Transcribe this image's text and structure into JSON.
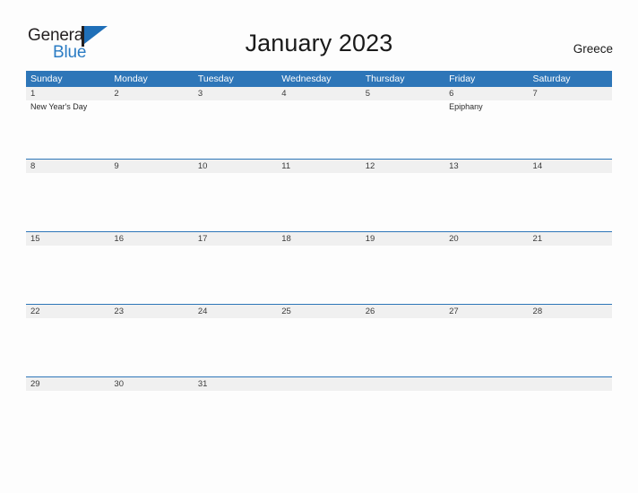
{
  "brand": {
    "name_part1": "General",
    "name_part2": "Blue",
    "flag_icon": "flag-icon",
    "accent_color": "#2b7cc4"
  },
  "header": {
    "title": "January 2023",
    "country": "Greece"
  },
  "calendar": {
    "header_bg_color": "#2e76b8",
    "band_color": "#f0f0f0",
    "weekday_labels": [
      "Sunday",
      "Monday",
      "Tuesday",
      "Wednesday",
      "Thursday",
      "Friday",
      "Saturday"
    ],
    "weeks": [
      {
        "days": [
          {
            "date": "1",
            "events": [
              "New Year's Day"
            ]
          },
          {
            "date": "2",
            "events": []
          },
          {
            "date": "3",
            "events": []
          },
          {
            "date": "4",
            "events": []
          },
          {
            "date": "5",
            "events": []
          },
          {
            "date": "6",
            "events": [
              "Epiphany"
            ]
          },
          {
            "date": "7",
            "events": []
          }
        ]
      },
      {
        "days": [
          {
            "date": "8",
            "events": []
          },
          {
            "date": "9",
            "events": []
          },
          {
            "date": "10",
            "events": []
          },
          {
            "date": "11",
            "events": []
          },
          {
            "date": "12",
            "events": []
          },
          {
            "date": "13",
            "events": []
          },
          {
            "date": "14",
            "events": []
          }
        ]
      },
      {
        "days": [
          {
            "date": "15",
            "events": []
          },
          {
            "date": "16",
            "events": []
          },
          {
            "date": "17",
            "events": []
          },
          {
            "date": "18",
            "events": []
          },
          {
            "date": "19",
            "events": []
          },
          {
            "date": "20",
            "events": []
          },
          {
            "date": "21",
            "events": []
          }
        ]
      },
      {
        "days": [
          {
            "date": "22",
            "events": []
          },
          {
            "date": "23",
            "events": []
          },
          {
            "date": "24",
            "events": []
          },
          {
            "date": "25",
            "events": []
          },
          {
            "date": "26",
            "events": []
          },
          {
            "date": "27",
            "events": []
          },
          {
            "date": "28",
            "events": []
          }
        ]
      },
      {
        "days": [
          {
            "date": "29",
            "events": []
          },
          {
            "date": "30",
            "events": []
          },
          {
            "date": "31",
            "events": []
          },
          {
            "date": "",
            "events": []
          },
          {
            "date": "",
            "events": []
          },
          {
            "date": "",
            "events": []
          },
          {
            "date": "",
            "events": []
          }
        ]
      }
    ]
  }
}
